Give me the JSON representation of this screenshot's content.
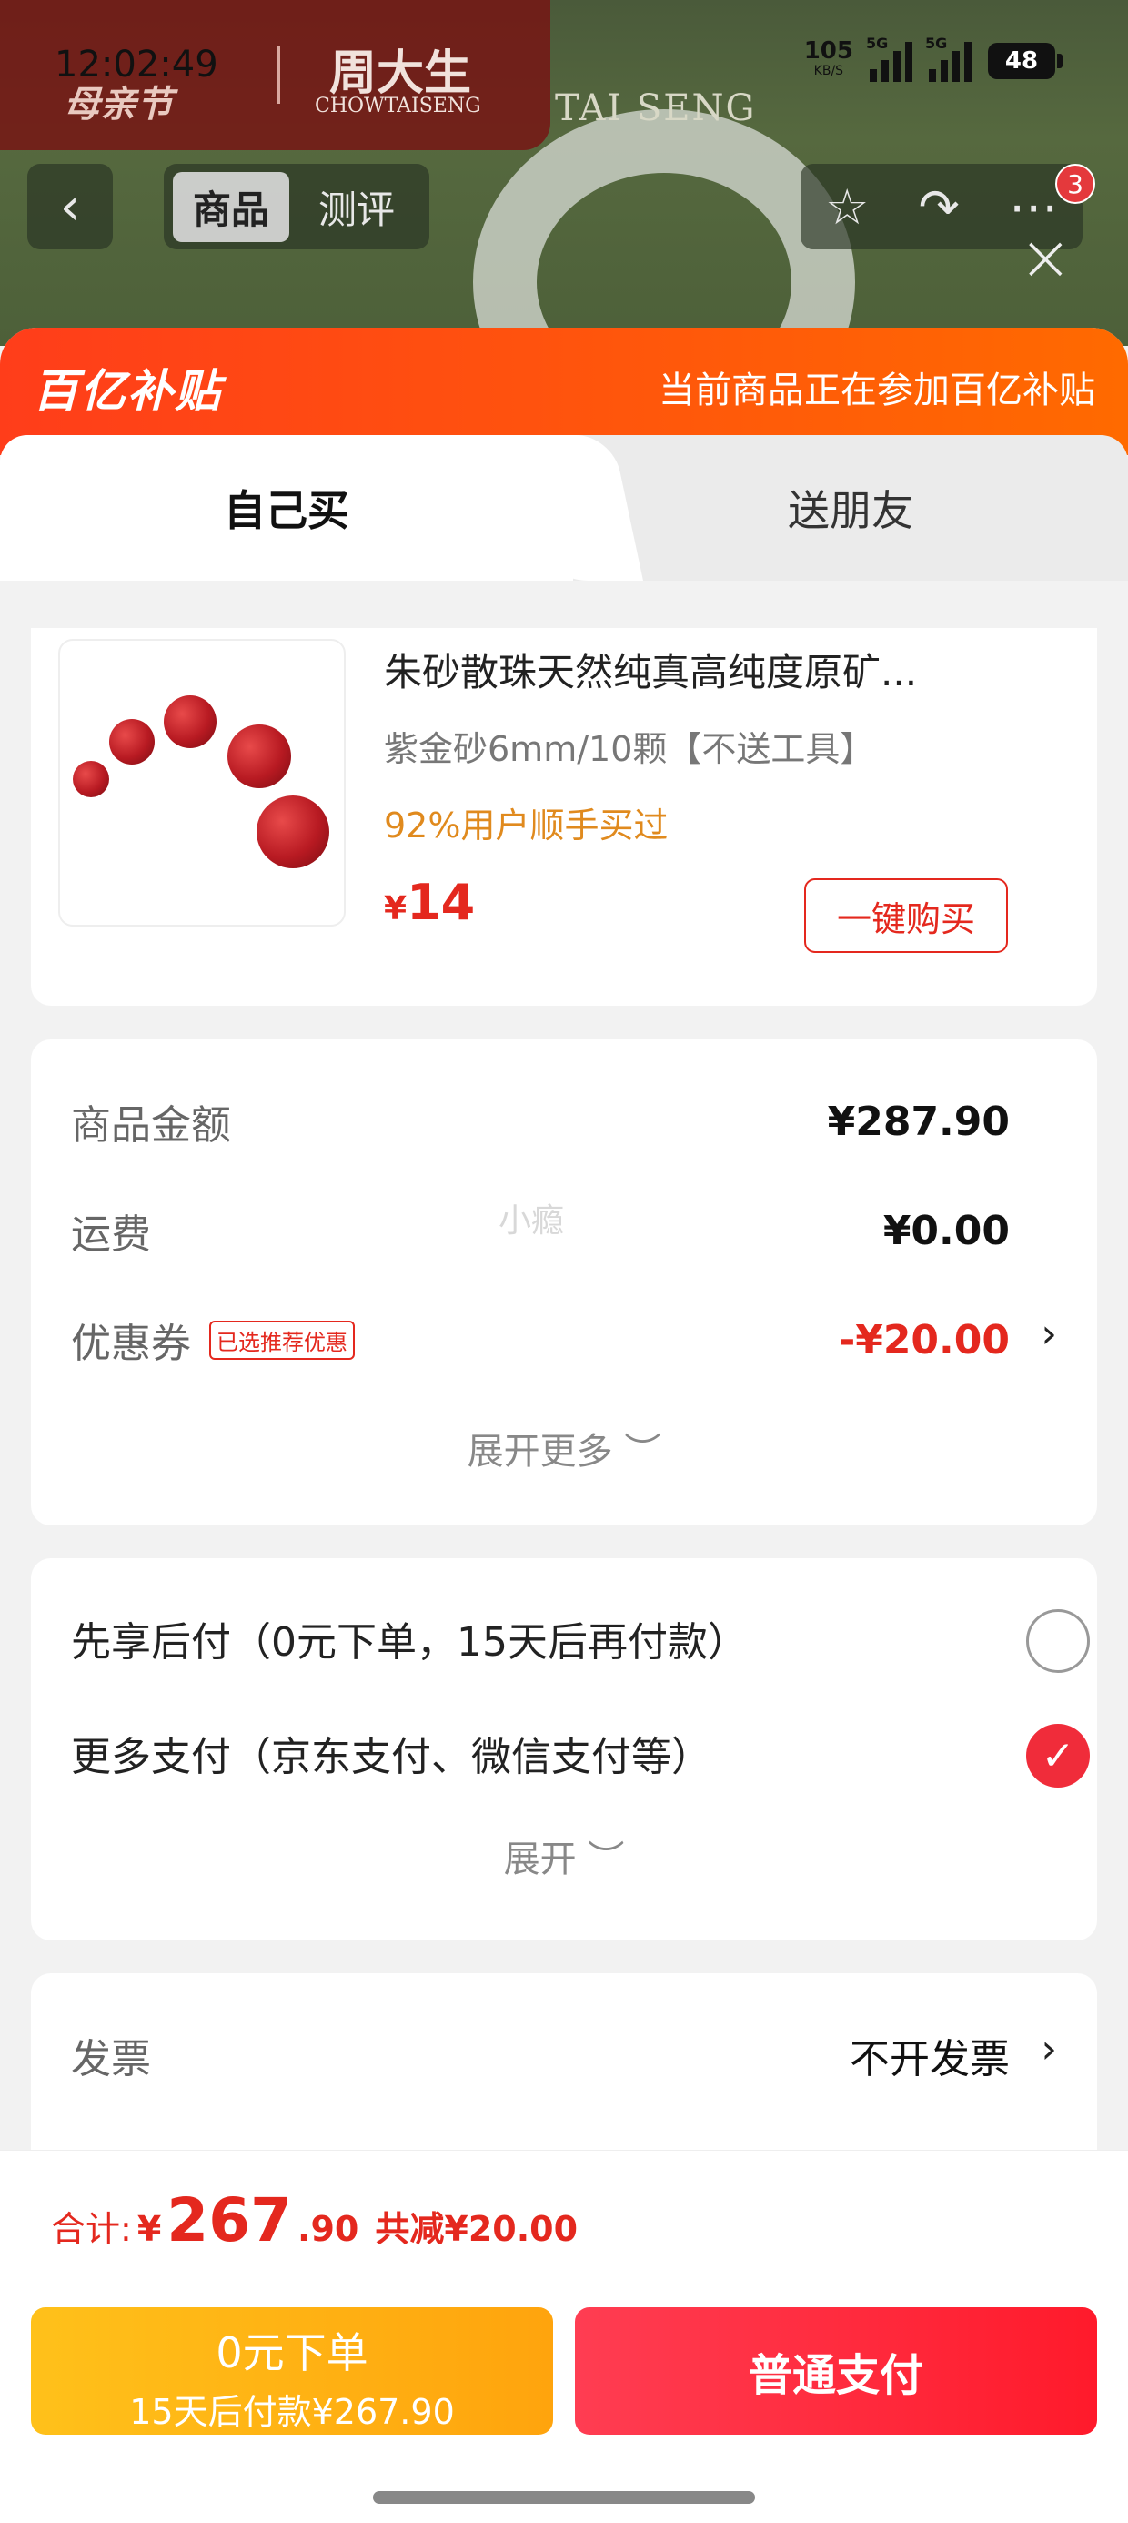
{
  "status_bar": {
    "time": "12:02:49",
    "speed_value": "105",
    "speed_unit": "KB/S",
    "signal1_label": "5G",
    "signal2_label": "5G",
    "battery": "48"
  },
  "promo_banner": {
    "festival": "母亲节",
    "brand_cn": "周大生",
    "brand_en": "CHOWTAISENG",
    "bg_brand": "TAI SENG"
  },
  "nav": {
    "tabs": [
      {
        "label": "商品"
      },
      {
        "label": "测评"
      }
    ],
    "badge_count": "3"
  },
  "subsidy": {
    "logo": "百亿补贴",
    "note": "当前商品正在参加百亿补贴"
  },
  "purchase_tabs": {
    "self": "自己买",
    "gift": "送朋友"
  },
  "product": {
    "title": "朱砂散珠天然纯真高纯度原矿...",
    "spec": "紫金砂6mm/10颗【不送工具】",
    "bought": "92%用户顺手买过",
    "currency": "¥",
    "price": "14",
    "buy_button": "一键购买"
  },
  "amounts": {
    "goods_label": "商品金额",
    "goods_value": "¥287.90",
    "shipping_label": "运费",
    "shipping_value": "¥0.00",
    "coupon_label": "优惠券",
    "coupon_tag": "已选推荐优惠",
    "coupon_value": "-¥20.00",
    "expand_more": "展开更多"
  },
  "watermark": "小瘾",
  "payment": {
    "option1": "先享后付（0元下单，15天后再付款）",
    "option2": "更多支付（京东支付、微信支付等）",
    "expand": "展开"
  },
  "invoice": {
    "label": "发票",
    "value": "不开发票"
  },
  "bottom": {
    "total_label": "合计:",
    "currency": "¥",
    "total_int": "267",
    "total_dec": ".90",
    "saved": "共减¥20.00",
    "zero_btn_line1": "0元下单",
    "zero_btn_line2": "15天后付款¥267.90",
    "normal_btn": "普通支付"
  },
  "colors": {
    "accent_red": "#e4281e",
    "subsidy_orange": "#ff4d12",
    "pay_yellow": "#ffb414",
    "pay_red": "#ff2236"
  }
}
